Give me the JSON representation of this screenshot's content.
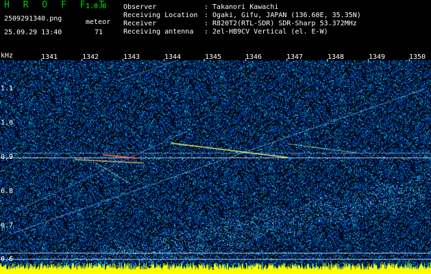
{
  "header": {
    "app_title": "H R O F F T",
    "version": "1.0.0",
    "filename": "2509291340.png",
    "timestamp": "25.09.29 13:40",
    "meteor_label": "meteor",
    "meteor_count": "71",
    "info": [
      {
        "key": "Observer",
        "value": ": Takanori Kawachi"
      },
      {
        "key": "Receiving Location",
        "value": ": Ogaki, Gifu, JAPAN (136.60E, 35.35N)"
      },
      {
        "key": "Receiver",
        "value": ": R820T2(RTL-SDR) SDR-Sharp 53.372MHz"
      },
      {
        "key": "Receiving antenna",
        "value": ": 2el-HB9CV Vertical (el. E-W)"
      }
    ]
  },
  "spectrogram": {
    "unit_label": "kHz",
    "x_ticks": [
      "1341",
      "1342",
      "1343",
      "1344",
      "1345",
      "1346",
      "1347",
      "1348",
      "1349",
      "1350"
    ],
    "y_ticks": [
      "1.1",
      "1.0",
      "0.9",
      "0.8",
      "0.7",
      "0.6"
    ]
  },
  "colors": {
    "background": "#000000",
    "noise": "#0a1a7a",
    "signal": "#ffff00",
    "title": "#00cc00"
  }
}
